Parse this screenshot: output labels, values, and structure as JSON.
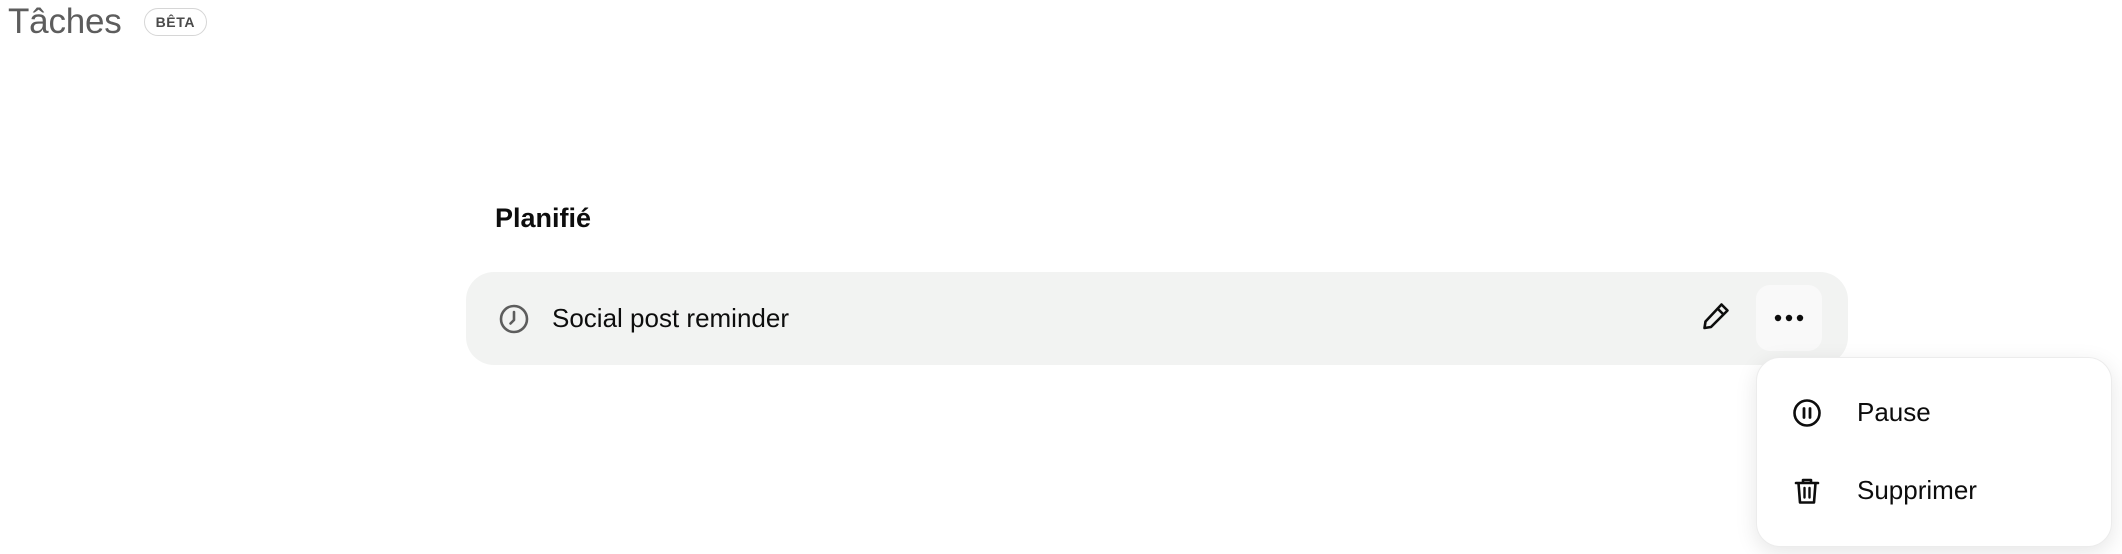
{
  "header": {
    "title": "Tâches",
    "badge": "BÊTA"
  },
  "section": {
    "title": "Planifié"
  },
  "tasks": [
    {
      "title": "Social post reminder",
      "icon": "clock-icon"
    }
  ],
  "row_actions": {
    "edit_icon": "pencil-icon",
    "more_icon": "more-horizontal-icon"
  },
  "menu": {
    "items": [
      {
        "label": "Pause",
        "icon": "pause-circle-icon"
      },
      {
        "label": "Supprimer",
        "icon": "trash-icon"
      }
    ]
  },
  "colors": {
    "row_background": "#f2f3f2",
    "title_gray": "#5d5d5d",
    "text": "#0d0d0d"
  }
}
